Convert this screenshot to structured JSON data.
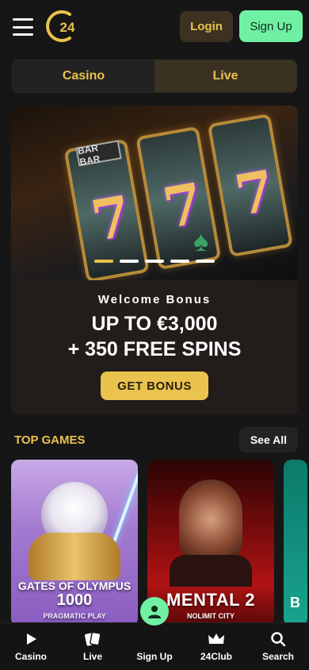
{
  "header": {
    "logo_text": "24",
    "login_label": "Login",
    "signup_label": "Sign Up"
  },
  "tabs": [
    {
      "label": "Casino"
    },
    {
      "label": "Live"
    }
  ],
  "banner": {
    "bar_text": "BAR BAR",
    "bonus_label": "Welcome Bonus",
    "line1": "UP TO €3,000",
    "line2": "+ 350 FREE SPINS",
    "button_label": "GET BONUS",
    "slides_count": 5,
    "active_slide": 1
  },
  "top_games": {
    "title": "TOP GAMES",
    "see_all_label": "See All",
    "games": [
      {
        "title_line1": "GATES OF OLYMPUS",
        "title_line2": "1000",
        "provider": "PRAGMATIC PLAY"
      },
      {
        "title_line1": "MENTAL 2",
        "provider": "NOLIMIT CITY"
      },
      {
        "title_line1": "B"
      }
    ]
  },
  "bottom_nav": [
    {
      "label": "Casino",
      "icon": "play-icon"
    },
    {
      "label": "Live",
      "icon": "cards-icon"
    },
    {
      "label": "Sign Up",
      "icon": "user-icon"
    },
    {
      "label": "24Club",
      "icon": "crown-icon"
    },
    {
      "label": "Search",
      "icon": "search-icon"
    }
  ],
  "colors": {
    "accent_gold": "#e9c34d",
    "accent_green": "#6ff0a2",
    "background": "#161616"
  }
}
